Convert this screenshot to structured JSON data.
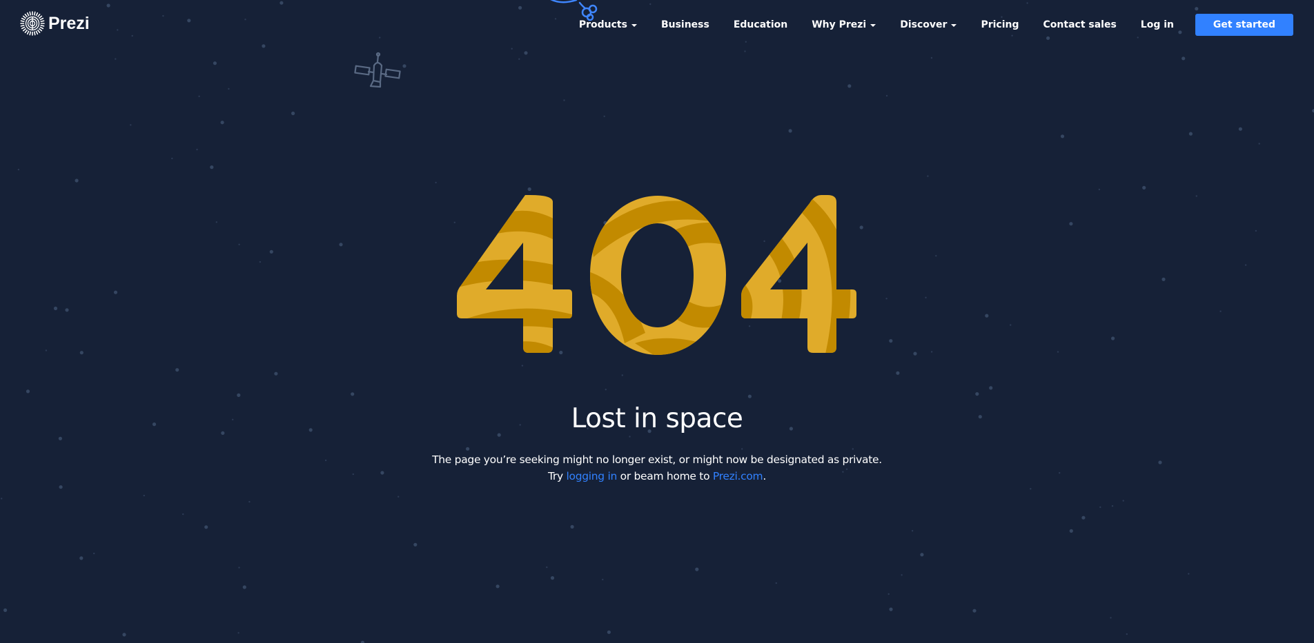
{
  "brand": {
    "name": "Prezi",
    "logo_icon": "prezi-logo-icon"
  },
  "nav": {
    "items": [
      {
        "label": "Products",
        "dropdown": true
      },
      {
        "label": "Business",
        "dropdown": false
      },
      {
        "label": "Education",
        "dropdown": false
      },
      {
        "label": "Why Prezi",
        "dropdown": true
      },
      {
        "label": "Discover",
        "dropdown": true
      },
      {
        "label": "Pricing",
        "dropdown": false
      },
      {
        "label": "Contact sales",
        "dropdown": false
      },
      {
        "label": "Log in",
        "dropdown": false
      }
    ],
    "cta_label": "Get started"
  },
  "error": {
    "code": "404",
    "title": "Lost in space",
    "line1": "The page you’re seeking might no longer exist, or might now be designated as private.",
    "line2_prefix": "Try",
    "login_link": "logging in",
    "line2_middle": "or beam home to",
    "home_link": "Prezi.com",
    "line2_suffix": "."
  },
  "colors": {
    "background": "#162137",
    "accent": "#3181ff",
    "digit_light": "#e0ab2a",
    "digit_dark": "#c28a00",
    "star": "#3a4a64",
    "decor_line": "#5a6a84",
    "rocket_line": "#3f86ff"
  },
  "icons": {
    "satellite": "satellite-icon",
    "rocket": "rocket-icon",
    "caret": "caret-down-icon"
  }
}
